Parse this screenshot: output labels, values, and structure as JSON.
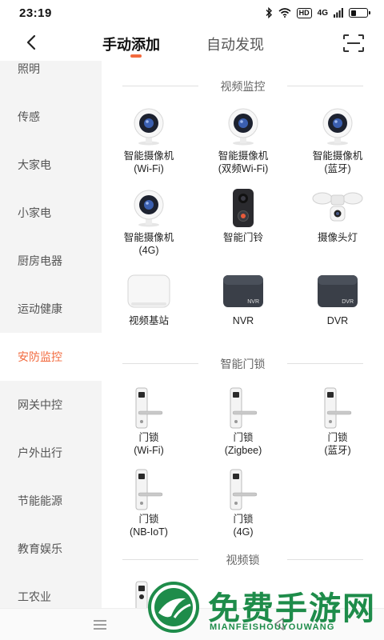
{
  "status_bar": {
    "time": "23:19",
    "hd_badge": "HD",
    "signal": "4G",
    "battery_level": 0.35
  },
  "header": {
    "tabs": [
      {
        "label": "手动添加",
        "active": true
      },
      {
        "label": "自动发现",
        "active": false
      }
    ]
  },
  "sidebar": {
    "items": [
      {
        "label": "照明",
        "active": false
      },
      {
        "label": "传感",
        "active": false
      },
      {
        "label": "大家电",
        "active": false
      },
      {
        "label": "小家电",
        "active": false
      },
      {
        "label": "厨房电器",
        "active": false
      },
      {
        "label": "运动健康",
        "active": false
      },
      {
        "label": "安防监控",
        "active": true
      },
      {
        "label": "网关中控",
        "active": false
      },
      {
        "label": "户外出行",
        "active": false
      },
      {
        "label": "节能能源",
        "active": false
      },
      {
        "label": "教育娱乐",
        "active": false
      },
      {
        "label": "工农业",
        "active": false
      }
    ]
  },
  "sections": [
    {
      "title": "视频监控",
      "devices": [
        {
          "line1": "智能摄像机",
          "line2": "(Wi-Fi)",
          "icon": "camera-icon"
        },
        {
          "line1": "智能摄像机",
          "line2": "(双频Wi-Fi)",
          "icon": "camera-icon"
        },
        {
          "line1": "智能摄像机",
          "line2": "(蓝牙)",
          "icon": "camera-icon"
        },
        {
          "line1": "智能摄像机",
          "line2": "(4G)",
          "icon": "camera-icon"
        },
        {
          "line1": "智能门铃",
          "line2": "",
          "icon": "doorbell-icon"
        },
        {
          "line1": "摄像头灯",
          "line2": "",
          "icon": "floodlight-camera-icon"
        },
        {
          "line1": "视频基站",
          "line2": "",
          "icon": "base-station-icon"
        },
        {
          "line1": "NVR",
          "line2": "",
          "icon": "nvr-icon",
          "badge": "NVR"
        },
        {
          "line1": "DVR",
          "line2": "",
          "icon": "dvr-icon",
          "badge": "DVR"
        }
      ]
    },
    {
      "title": "智能门锁",
      "devices": [
        {
          "line1": "门锁",
          "line2": "(Wi-Fi)",
          "icon": "door-lock-icon"
        },
        {
          "line1": "门锁",
          "line2": "(Zigbee)",
          "icon": "door-lock-icon"
        },
        {
          "line1": "门锁",
          "line2": "(蓝牙)",
          "icon": "door-lock-icon"
        },
        {
          "line1": "门锁",
          "line2": "(NB-IoT)",
          "icon": "door-lock-icon"
        },
        {
          "line1": "门锁",
          "line2": "(4G)",
          "icon": "door-lock-icon"
        }
      ]
    },
    {
      "title": "视频锁",
      "devices": []
    }
  ],
  "watermark": {
    "cn": "免费手游网",
    "en": "MIANFEISHOUYOUWANG"
  },
  "colors": {
    "accent": "#f26a3e",
    "sidebar_bg": "#f4f4f4",
    "watermark_green": "#1e8c4a"
  }
}
